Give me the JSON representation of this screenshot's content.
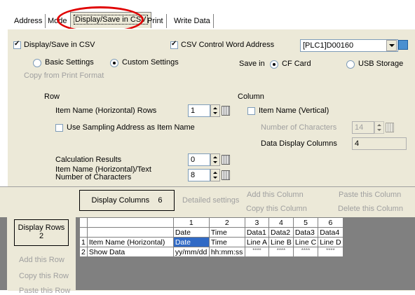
{
  "tabs": [
    "Address",
    "Mode",
    "Display/Save in CSV",
    "Print",
    "Write Data"
  ],
  "options": {
    "display_save_csv": "Display/Save in CSV",
    "csv_control_word_address": "CSV Control Word Address",
    "address_value": "[PLC1]D00160",
    "basic_settings": "Basic Settings",
    "custom_settings": "Custom Settings",
    "save_in": "Save in",
    "cf_card": "CF Card",
    "usb_storage": "USB Storage",
    "copy_from_print_format": "Copy from Print Format"
  },
  "row": {
    "heading": "Row",
    "item_name_rows_label": "Item Name (Horizontal) Rows",
    "item_name_rows_value": "1",
    "use_sampling": "Use Sampling Address as Item Name",
    "calc_results_label": "Calculation Results",
    "calc_results_value": "0",
    "text_chars_label_1": "Item Name (Horizontal)/Text",
    "text_chars_label_2": "Number of Characters",
    "text_chars_value": "8"
  },
  "column": {
    "heading": "Column",
    "item_name_vertical": "Item Name (Vertical)",
    "num_chars_label": "Number of Characters",
    "num_chars_value": "14",
    "data_display_cols_label": "Data Display Columns",
    "data_display_cols_value": "4"
  },
  "toolbar": {
    "display_columns_label": "Display Columns",
    "display_columns_value": "6",
    "detailed_settings": "Detailed settings",
    "add_column": "Add this Column",
    "copy_column": "Copy this Column",
    "paste_column": "Paste this Column",
    "delete_column": "Delete this Column",
    "display_rows_label": "Display Rows",
    "display_rows_value": "2",
    "add_row": "Add this Row",
    "copy_row": "Copy this Row",
    "paste_row": "Paste this Row"
  },
  "grid": {
    "col_numbers": [
      "1",
      "2",
      "3",
      "4",
      "5",
      "6"
    ],
    "col_headers": [
      "Date",
      "Time",
      "Data1",
      "Data2",
      "Data3",
      "Data4"
    ],
    "rows": [
      {
        "num": "1",
        "label": "Item Name (Horizontal)",
        "cells": [
          "Date",
          "Time",
          "Line A",
          "Line B",
          "Line C",
          "Line D"
        ]
      },
      {
        "num": "2",
        "label": "Show Data",
        "cells": [
          "yy/mm/dd",
          "hh:mm:ss",
          "****",
          "****",
          "****",
          "****"
        ]
      }
    ]
  }
}
